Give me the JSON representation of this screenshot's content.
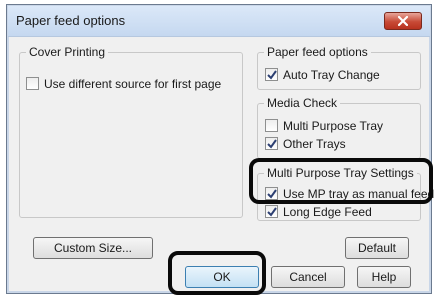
{
  "window": {
    "title": "Paper feed options"
  },
  "cover_printing": {
    "label": "Cover Printing",
    "use_different_source": {
      "label": "Use different source for first page",
      "checked": false
    }
  },
  "paper_feed_options": {
    "label": "Paper feed options",
    "auto_tray_change": {
      "label": "Auto Tray Change",
      "checked": true
    }
  },
  "media_check": {
    "label": "Media Check",
    "multi_purpose_tray": {
      "label": "Multi Purpose Tray",
      "checked": false
    },
    "other_trays": {
      "label": "Other Trays",
      "checked": true
    }
  },
  "mp_tray_settings": {
    "label": "Multi Purpose Tray Settings",
    "use_mp_manual": {
      "label": "Use MP tray as manual feed",
      "checked": true
    },
    "long_edge_feed": {
      "label": "Long Edge Feed",
      "checked": true
    }
  },
  "buttons": {
    "custom_size": "Custom Size...",
    "default": "Default",
    "ok": "OK",
    "cancel": "Cancel",
    "help": "Help"
  }
}
